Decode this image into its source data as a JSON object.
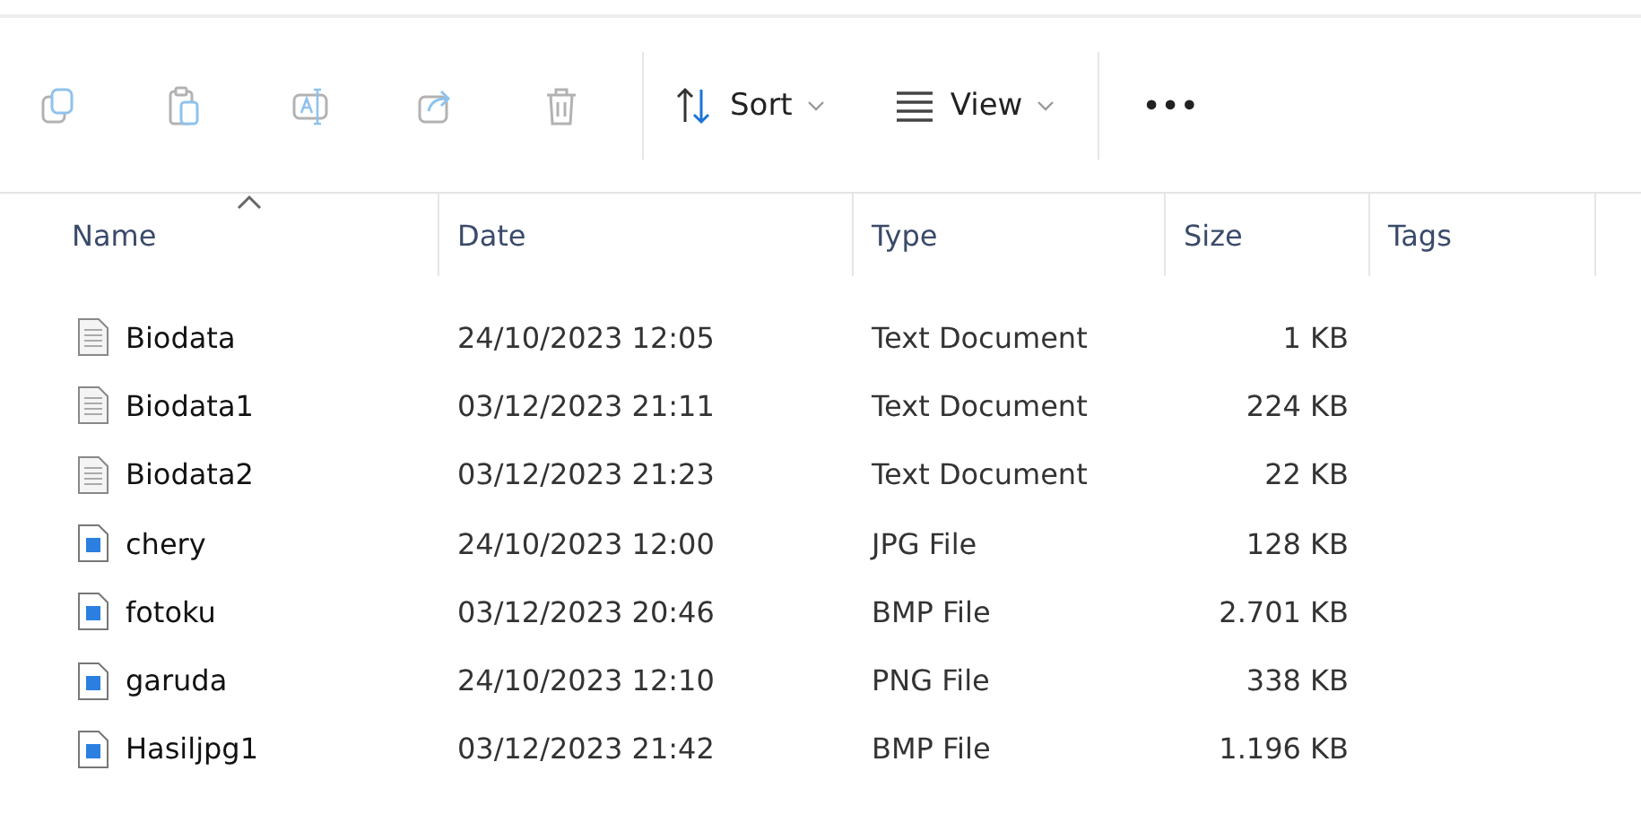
{
  "toolbar": {
    "actions": [
      {
        "kind": "copy",
        "disabled": true
      },
      {
        "kind": "paste",
        "disabled": true
      },
      {
        "kind": "rename",
        "disabled": true
      },
      {
        "kind": "share",
        "disabled": true
      },
      {
        "kind": "delete",
        "disabled": true
      }
    ],
    "menus": [
      {
        "kind": "sort",
        "label": "Sort"
      },
      {
        "kind": "view",
        "label": "View"
      }
    ],
    "more": {
      "label": "•••"
    }
  },
  "table": {
    "columns": [
      {
        "label": "Name",
        "sorted": true
      },
      {
        "label": "Date",
        "sorted": false
      },
      {
        "label": "Type",
        "sorted": false
      },
      {
        "label": "Size",
        "sorted": false
      },
      {
        "label": "Tags",
        "sorted": false
      }
    ],
    "rows": [
      {
        "kind": "text",
        "name": "Biodata",
        "date": "24/10/2023 12:05",
        "type": "Text Document",
        "size": "1 KB"
      },
      {
        "kind": "text",
        "name": "Biodata1",
        "date": "03/12/2023 21:11",
        "type": "Text Document",
        "size": "224 KB"
      },
      {
        "kind": "text",
        "name": "Biodata2",
        "date": "03/12/2023 21:23",
        "type": "Text Document",
        "size": "22 KB"
      },
      {
        "kind": "image",
        "name": "chery",
        "date": "24/10/2023 12:00",
        "type": "JPG File",
        "size": "128 KB"
      },
      {
        "kind": "image",
        "name": "fotoku",
        "date": "03/12/2023 20:46",
        "type": "BMP File",
        "size": "2.701 KB"
      },
      {
        "kind": "image",
        "name": "garuda",
        "date": "24/10/2023 12:10",
        "type": "PNG File",
        "size": "338 KB"
      },
      {
        "kind": "image",
        "name": "Hasiljpg1",
        "date": "03/12/2023 21:42",
        "type": "BMP File",
        "size": "1.196 KB"
      }
    ]
  }
}
